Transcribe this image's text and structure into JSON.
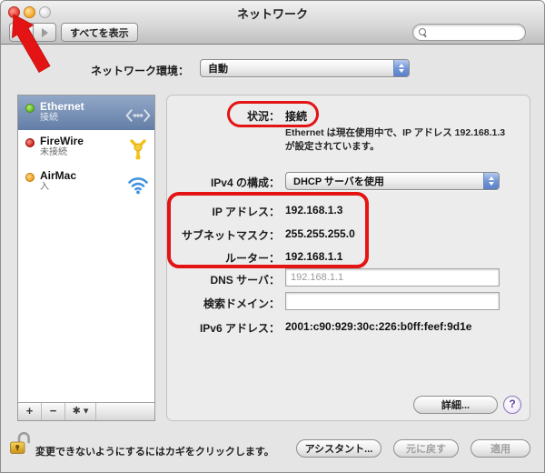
{
  "window": {
    "title": "ネットワーク"
  },
  "toolbar": {
    "show_all_label": "すべてを表示",
    "search_placeholder": ""
  },
  "location": {
    "label": "ネットワーク環境：",
    "value": "自動"
  },
  "sidebar": {
    "items": [
      {
        "name": "Ethernet",
        "status": "接続",
        "dot_color": "green",
        "icon": "ethernet-icon",
        "selected": true
      },
      {
        "name": "FireWire",
        "status": "未接続",
        "dot_color": "red",
        "icon": "firewire-icon",
        "selected": false
      },
      {
        "name": "AirMac",
        "status": "入",
        "dot_color": "orange",
        "icon": "wifi-icon",
        "selected": false
      }
    ],
    "add_label": "+",
    "remove_label": "−",
    "gear_label": "✱ ▾"
  },
  "main": {
    "status": {
      "label": "状況：",
      "value": "接続",
      "description": "Ethernet は現在使用中で、IP アドレス 192.168.1.3 が設定されています。"
    },
    "ipv4_config": {
      "label": "IPv4 の構成：",
      "value": "DHCP サーバを使用"
    },
    "fields": [
      {
        "label": "IP アドレス：",
        "value": "192.168.1.3"
      },
      {
        "label": "サブネットマスク：",
        "value": "255.255.255.0"
      },
      {
        "label": "ルーター：",
        "value": "192.168.1.1"
      }
    ],
    "dns": {
      "label": "DNS サーバ：",
      "value": "192.168.1.1"
    },
    "search_domain": {
      "label": "検索ドメイン：",
      "value": ""
    },
    "ipv6": {
      "label": "IPv6 アドレス：",
      "value": "2001:c90:929:30c:226:b0ff:feef:9d1e"
    },
    "advanced_label": "詳細...",
    "help_label": "?"
  },
  "footer": {
    "lock_text": "変更できないようにするにはカギをクリックします。",
    "assistant_label": "アシスタント...",
    "revert_label": "元に戻す",
    "apply_label": "適用"
  },
  "colors": {
    "annotation_red": "#e41414",
    "selection_top": "#92a8c8",
    "selection_bottom": "#627da6",
    "status_green": "#5db31e",
    "status_red": "#c6170f",
    "status_orange": "#ef9c14"
  }
}
